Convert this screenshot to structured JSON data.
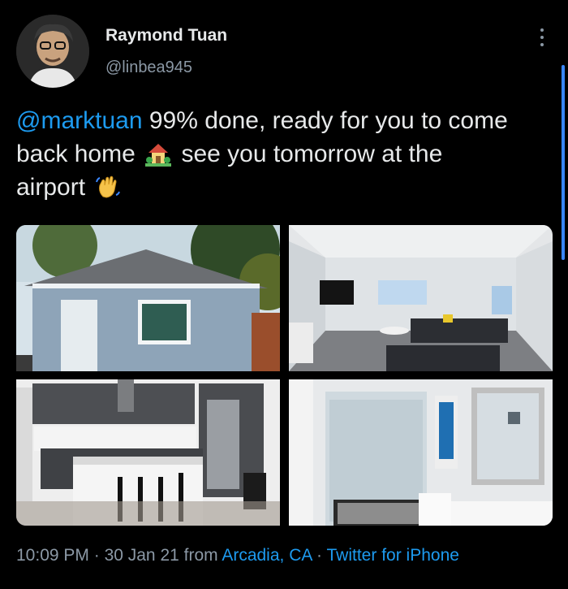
{
  "user": {
    "name": "Raymond Tuan",
    "handle": "@linbea945"
  },
  "tweet": {
    "mention": "@marktuan",
    "text_line1": " 99% done, ready for you to come",
    "text_line2a": "back home",
    "text_line2b": "see you tomorrow at the",
    "text_line3": "airport",
    "emoji_house": "house-with-garden-emoji",
    "emoji_wave": "waving-hand-emoji"
  },
  "media": {
    "images": [
      {
        "subject": "exterior-house"
      },
      {
        "subject": "living-room"
      },
      {
        "subject": "kitchen"
      },
      {
        "subject": "bathroom"
      }
    ]
  },
  "meta": {
    "time": "10:09 PM",
    "sep1": " · ",
    "date": "30 Jan 21",
    "from": " from ",
    "location": "Arcadia, CA",
    "sep2": " · ",
    "client": "Twitter for iPhone"
  },
  "colors": {
    "background": "#000000",
    "text": "#e7e9ea",
    "secondary": "#8b98a5",
    "link": "#1d9bf0"
  }
}
